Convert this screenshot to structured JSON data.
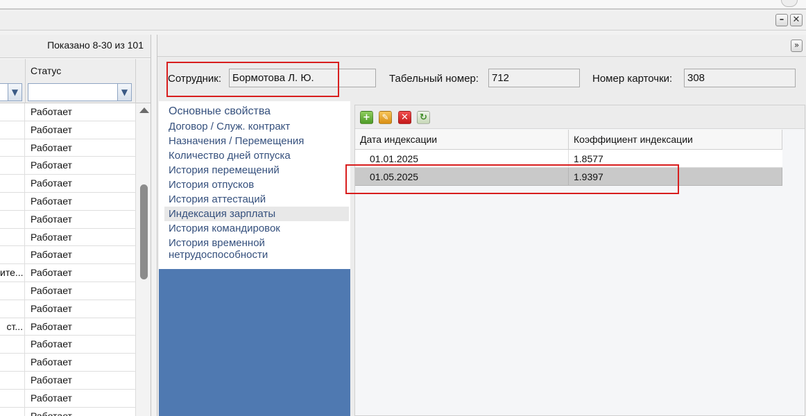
{
  "left_panel": {
    "shown_count": "Показано 8-30 из 101",
    "status_header": "Статус",
    "rows": [
      {
        "c1": "",
        "status": "Работает"
      },
      {
        "c1": "",
        "status": "Работает"
      },
      {
        "c1": "",
        "status": "Работает"
      },
      {
        "c1": "",
        "status": "Работает"
      },
      {
        "c1": "",
        "status": "Работает"
      },
      {
        "c1": "",
        "status": "Работает"
      },
      {
        "c1": "",
        "status": "Работает"
      },
      {
        "c1": "",
        "status": "Работает"
      },
      {
        "c1": "",
        "status": "Работает"
      },
      {
        "c1": "ите...",
        "status": "Работает"
      },
      {
        "c1": "",
        "status": "Работает"
      },
      {
        "c1": "",
        "status": "Работает"
      },
      {
        "c1": "ст...",
        "status": "Работает"
      },
      {
        "c1": "",
        "status": "Работает"
      },
      {
        "c1": "",
        "status": "Работает"
      },
      {
        "c1": "",
        "status": "Работает"
      },
      {
        "c1": "",
        "status": "Работает"
      },
      {
        "c1": "",
        "status": "Работает"
      }
    ]
  },
  "employee": {
    "label": "Сотрудник:",
    "value": "Бормотова Л. Ю.",
    "tab_number_label": "Табельный номер:",
    "tab_number": "712",
    "card_number_label": "Номер карточки:",
    "card_number": "308"
  },
  "nav": {
    "items": [
      "Основные свойства",
      "Договор / Служ. контракт",
      "Назначения / Перемещения",
      "Количество дней отпуска",
      "История перемещений",
      "История отпусков",
      "История аттестаций",
      "Индексация зарплаты",
      "История командировок",
      "История временной нетрудоспособности"
    ],
    "active_index": 7
  },
  "grid": {
    "columns": [
      "Дата индексации",
      "Коэффициент индексации"
    ],
    "rows": [
      {
        "date": "01.01.2025",
        "coef": "1.8577"
      },
      {
        "date": "01.05.2025",
        "coef": "1.9397"
      }
    ],
    "selected_row": 1,
    "toolbar_icons": [
      "add-icon",
      "edit-icon",
      "delete-icon",
      "refresh-icon"
    ]
  },
  "colors": {
    "nav_background": "#4f79b1",
    "nav_text": "#35507d",
    "highlight_border": "#d81e1e",
    "selected_row": "#c9c9c9"
  }
}
